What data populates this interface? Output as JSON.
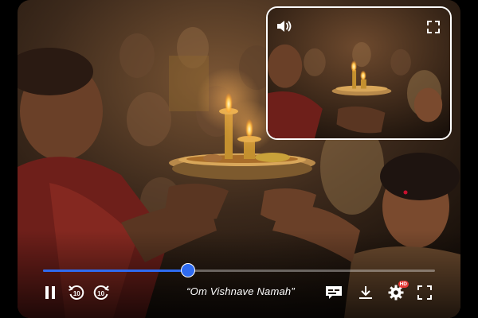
{
  "video": {
    "scene_description_icon": "aarti-ceremony-scene",
    "progress_fraction": 0.37,
    "accent_color": "#2f6bf0"
  },
  "controls": {
    "play_state_icon": "pause-icon",
    "rewind_seconds": "10",
    "forward_seconds": "10",
    "caption_text": "“Om Vishnave Namah”",
    "quality_badge": "HD"
  },
  "pip": {
    "volume_icon": "volume-icon",
    "fullscreen_icon": "fullscreen-icon"
  }
}
